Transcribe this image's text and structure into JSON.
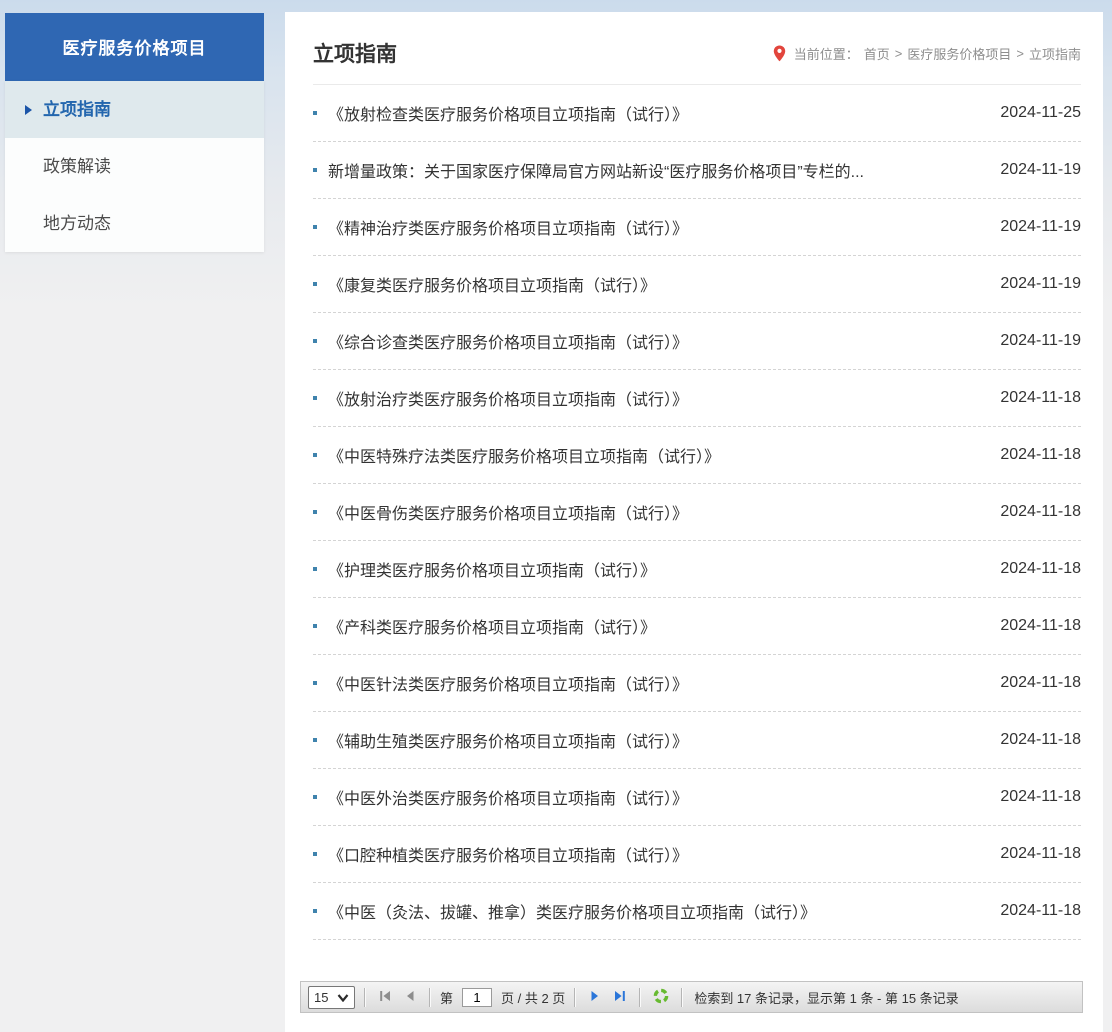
{
  "sidebar": {
    "title": "医疗服务价格项目",
    "items": [
      {
        "label": "立项指南",
        "active": true
      },
      {
        "label": "政策解读",
        "active": false
      },
      {
        "label": "地方动态",
        "active": false
      }
    ]
  },
  "main": {
    "title": "立项指南",
    "breadcrumb": {
      "prefix": "当前位置：",
      "separator": ">",
      "items": [
        "首页",
        "医疗服务价格项目",
        "立项指南"
      ]
    },
    "list": [
      {
        "title": "《放射检查类医疗服务价格项目立项指南（试行）》",
        "date": "2024-11-25"
      },
      {
        "title": "新增量政策：关于国家医疗保障局官方网站新设“医疗服务价格项目”专栏的...",
        "date": "2024-11-19"
      },
      {
        "title": "《精神治疗类医疗服务价格项目立项指南（试行）》",
        "date": "2024-11-19"
      },
      {
        "title": "《康复类医疗服务价格项目立项指南（试行）》",
        "date": "2024-11-19"
      },
      {
        "title": "《综合诊查类医疗服务价格项目立项指南（试行）》",
        "date": "2024-11-19"
      },
      {
        "title": "《放射治疗类医疗服务价格项目立项指南（试行）》",
        "date": "2024-11-18"
      },
      {
        "title": "《中医特殊疗法类医疗服务价格项目立项指南（试行）》",
        "date": "2024-11-18"
      },
      {
        "title": "《中医骨伤类医疗服务价格项目立项指南（试行）》",
        "date": "2024-11-18"
      },
      {
        "title": "《护理类医疗服务价格项目立项指南（试行）》",
        "date": "2024-11-18"
      },
      {
        "title": "《产科类医疗服务价格项目立项指南（试行）》",
        "date": "2024-11-18"
      },
      {
        "title": "《中医针法类医疗服务价格项目立项指南（试行）》",
        "date": "2024-11-18"
      },
      {
        "title": "《辅助生殖类医疗服务价格项目立项指南（试行）》",
        "date": "2024-11-18"
      },
      {
        "title": "《中医外治类医疗服务价格项目立项指南（试行）》",
        "date": "2024-11-18"
      },
      {
        "title": "《口腔种植类医疗服务价格项目立项指南（试行）》",
        "date": "2024-11-18"
      },
      {
        "title": "《中医（灸法、拔罐、推拿）类医疗服务价格项目立项指南（试行）》",
        "date": "2024-11-18"
      }
    ]
  },
  "pager": {
    "page_size": "15",
    "page_prefix": "第",
    "page_value": "1",
    "page_suffix": "页 / 共 2 页",
    "summary": "检索到 17 条记录，显示第 1 条 - 第 15 条记录"
  },
  "colors": {
    "sidebar_blue": "#2f67b3",
    "active_item_bg": "#dfe9ed",
    "active_text_blue": "#2366ae",
    "pin_red": "#e2453c",
    "pager_arrow_blue": "#2b76d9",
    "pager_arrow_grey": "#8d8d8d",
    "refresh_green": "#67ba30"
  }
}
